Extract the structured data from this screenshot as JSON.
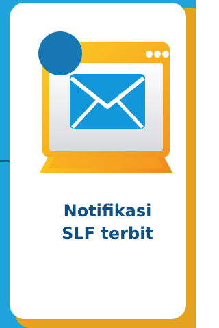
{
  "card": {
    "title_line1": "Notifikasi",
    "title_line2": "SLF terbit"
  },
  "icons": {
    "monitor": "monitor-icon",
    "envelope": "envelope-icon",
    "badge": "notification-badge-icon"
  },
  "colors": {
    "background": "#1fa3dc",
    "card_shadow": "#e4a21f",
    "title": "#0d4f86",
    "monitor_frame": "#f7b124",
    "badge": "#1677b3",
    "envelope": "#1298da"
  }
}
